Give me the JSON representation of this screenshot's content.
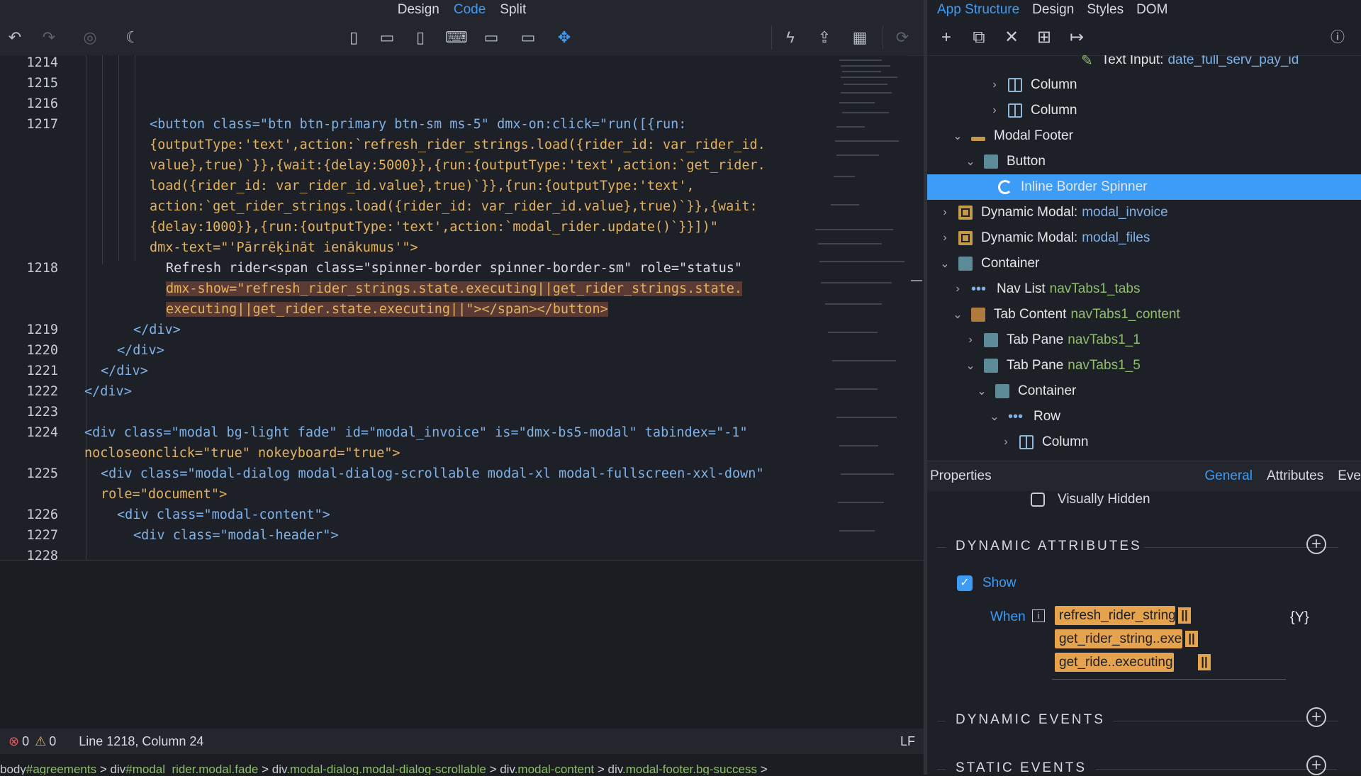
{
  "view_tabs": [
    "Design",
    "Code",
    "Split"
  ],
  "active_view_tab": "Code",
  "toolbar_icons": [
    "undo-icon",
    "redo-icon",
    "camera-icon",
    "moon-icon",
    "phone-portrait-icon",
    "phone-landscape-icon",
    "tablet-portrait-icon",
    "laptop-icon",
    "desktop-icon",
    "monitor-icon",
    "move-icon",
    "lightning-icon",
    "share-icon",
    "qr-code-icon",
    "refresh-icon"
  ],
  "code": {
    "lines": [
      {
        "num": "1214"
      },
      {
        "num": "1215"
      },
      {
        "num": "1216"
      },
      {
        "num": "1217"
      },
      {
        "num": "1218"
      },
      {
        "num": "1219"
      },
      {
        "num": "1220"
      },
      {
        "num": "1221"
      },
      {
        "num": "1222"
      },
      {
        "num": "1223"
      },
      {
        "num": "1224"
      },
      {
        "num": "1225"
      },
      {
        "num": "1226"
      },
      {
        "num": "1227"
      },
      {
        "num": "1228"
      }
    ],
    "l1217": [
      "<button class=\"btn btn-primary btn-sm ms-5\" dmx-on:click=\"run([{run:",
      "{outputType:'text',action:`refresh_rider_strings.load({rider_id: var_rider_id.",
      "value},true)`}},{wait:{delay:5000}},{run:{outputType:'text',action:`get_rider.",
      "load({rider_id: var_rider_id.value},true)`}},{run:{outputType:'text',",
      "action:`get_rider_strings.load({rider_id: var_rider_id.value},true)`}},{wait:",
      "{delay:1000}},{run:{outputType:'text',action:`modal_rider.update()`}}])\"",
      "dmx-text=\"'Pārrēķināt ienākumus'\">"
    ],
    "l1218": [
      "Refresh rider<span class=\"spinner-border spinner-border-sm\" role=\"status\"",
      "dmx-show=\"refresh_rider_strings.state.executing||get_rider_strings.state.",
      "executing||get_rider.state.executing||\"></span></button>"
    ],
    "l1219": "</div>",
    "l1220": "</div>",
    "l1221": "</div>",
    "l1222": "</div>",
    "l1224": [
      "<div class=\"modal bg-light fade\" id=\"modal_invoice\" is=\"dmx-bs5-modal\" tabindex=\"-1\"",
      "nocloseonclick=\"true\" nokeyboard=\"true\">"
    ],
    "l1225": [
      "<div class=\"modal-dialog modal-dialog-scrollable modal-xl modal-fullscreen-xxl-down\"",
      "role=\"document\">"
    ],
    "l1226": "<div class=\"modal-content\">",
    "l1227": "<div class=\"modal-header\">"
  },
  "status": {
    "errors": "0",
    "warnings": "0",
    "position": "Line 1218, Column 24",
    "line_ending": "LF"
  },
  "breadcrumb": [
    {
      "k": "body",
      "v": "#agreements"
    },
    {
      "k": "div",
      "v": "#modal_rider.modal.fade"
    },
    {
      "k": "div",
      "v": ".modal-dialog.modal-dialog-scrollable"
    },
    {
      "k": "div",
      "v": ".modal-content"
    },
    {
      "k": "div",
      "v": ".modal-footer.bg-success"
    }
  ],
  "right_tabs": [
    "App Structure",
    "Design",
    "Styles",
    "DOM"
  ],
  "active_right_tab": "App Structure",
  "right_tools": [
    "plus-icon",
    "copy-icon",
    "close-icon",
    "component-icon",
    "exit-icon",
    "help-icon"
  ],
  "tree": [
    {
      "label": "Text Input:",
      "name": "date_full_serv_pay_id",
      "icon": "pencil",
      "indent": 5,
      "chev": ""
    },
    {
      "label": "Column",
      "name": "",
      "icon": "col",
      "indent": 4,
      "chev": ">"
    },
    {
      "label": "Column",
      "name": "",
      "icon": "col",
      "indent": 4,
      "chev": ">"
    },
    {
      "label": "Modal Footer",
      "name": "",
      "icon": "footer",
      "indent": 3,
      "chev": "v"
    },
    {
      "label": "Button",
      "name": "",
      "icon": "teal",
      "indent": 4,
      "chev": "v"
    },
    {
      "label": "Inline Border Spinner",
      "name": "",
      "icon": "spin",
      "indent": 5,
      "chev": "",
      "selected": true
    },
    {
      "label": "Dynamic Modal:",
      "name": "modal_invoice",
      "icon": "modal",
      "indent": 2,
      "chev": ">",
      "blue": true
    },
    {
      "label": "Dynamic Modal:",
      "name": "modal_files",
      "icon": "modal",
      "indent": 2,
      "chev": ">",
      "blue": true
    },
    {
      "label": "Container",
      "name": "",
      "icon": "teal",
      "indent": 2,
      "chev": "v"
    },
    {
      "label": "Nav List",
      "name": "navTabs1_tabs",
      "icon": "dots",
      "indent": 3,
      "chev": ">"
    },
    {
      "label": "Tab Content",
      "name": "navTabs1_content",
      "icon": "brown",
      "indent": 3,
      "chev": "v"
    },
    {
      "label": "Tab Pane",
      "name": "navTabs1_1",
      "icon": "teal",
      "indent": 4,
      "chev": ">"
    },
    {
      "label": "Tab Pane",
      "name": "navTabs1_5",
      "icon": "teal",
      "indent": 4,
      "chev": "v"
    },
    {
      "label": "Container",
      "name": "",
      "icon": "teal",
      "indent": 5,
      "chev": "v"
    },
    {
      "label": "Row",
      "name": "",
      "icon": "dots",
      "indent": 6,
      "chev": "v"
    },
    {
      "label": "Column",
      "name": "",
      "icon": "col",
      "indent": 7,
      "chev": ">"
    }
  ],
  "properties": {
    "title": "Properties",
    "tabs": [
      "General",
      "Attributes",
      "Eve"
    ],
    "active_tab": "General",
    "visually_hidden": "Visually Hidden",
    "dynamic_attributes": "DYNAMIC ATTRIBUTES",
    "show_label": "Show",
    "when_label": "When",
    "info_icon": "i",
    "expr_pills": [
      "refresh_rider_string..e...",
      "get_rider_string..execu...",
      "get_ride..executing"
    ],
    "or_op": "||",
    "filter_icon": "{Y}",
    "dynamic_events": "DYNAMIC EVENTS",
    "static_events": "STATIC EVENTS"
  }
}
